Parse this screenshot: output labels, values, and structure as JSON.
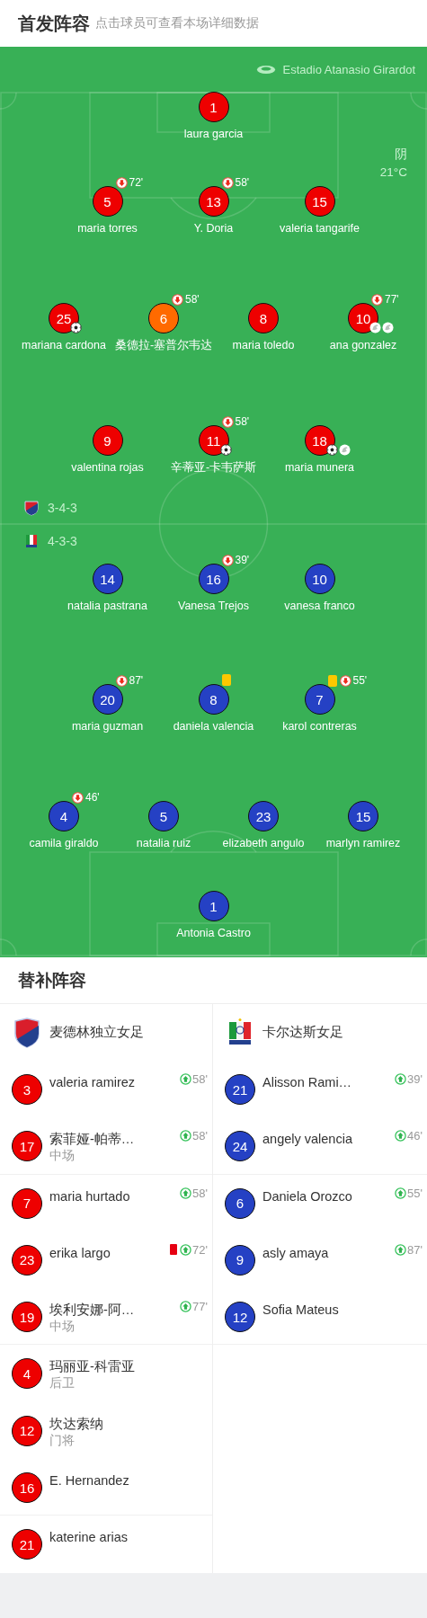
{
  "header": {
    "title": "首发阵容",
    "subtitle": "点击球员可查看本场详细数据"
  },
  "field": {
    "stadium": "Estadio Atanasio Girardot",
    "weather": "阴",
    "temperature": "21°C",
    "home": {
      "formation": "3-4-3",
      "lines": [
        {
          "players": [
            {
              "number": "1",
              "name": "laura garcia",
              "color": "#ee0000"
            }
          ]
        },
        {
          "players": [
            {
              "number": "5",
              "name": "maria torres",
              "color": "#ee0000",
              "events": [
                {
                  "kind": "sub_out",
                  "minute": "72'"
                }
              ]
            },
            {
              "number": "13",
              "name": "Y. Doria",
              "color": "#ee0000",
              "events": [
                {
                  "kind": "sub_out",
                  "minute": "58'"
                }
              ]
            },
            {
              "number": "15",
              "name": "valeria tangarife",
              "color": "#ee0000"
            }
          ]
        },
        {
          "players": [
            {
              "number": "25",
              "name": "mariana cardona",
              "color": "#ee0000",
              "events": [
                {
                  "kind": "goal"
                }
              ]
            },
            {
              "number": "6",
              "name": "桑德拉-塞普尔韦达",
              "color": "#ff6a00",
              "events": [
                {
                  "kind": "sub_out",
                  "minute": "58'"
                }
              ]
            },
            {
              "number": "8",
              "name": "maria toledo",
              "color": "#ee0000"
            },
            {
              "number": "10",
              "name": "ana gonzalez",
              "color": "#ee0000",
              "events": [
                {
                  "kind": "sub_out",
                  "minute": "77'"
                },
                {
                  "kind": "assist"
                },
                {
                  "kind": "assist"
                }
              ]
            }
          ]
        },
        {
          "players": [
            {
              "number": "9",
              "name": "valentina rojas",
              "color": "#ee0000"
            },
            {
              "number": "11",
              "name": "辛蒂亚-卡韦萨斯",
              "color": "#ee0000",
              "events": [
                {
                  "kind": "sub_out",
                  "minute": "58'"
                },
                {
                  "kind": "goal"
                }
              ]
            },
            {
              "number": "18",
              "name": "maria munera",
              "color": "#ee0000",
              "events": [
                {
                  "kind": "goal"
                },
                {
                  "kind": "assist"
                }
              ]
            }
          ]
        }
      ]
    },
    "away": {
      "formation": "4-3-3",
      "lines": [
        {
          "players": [
            {
              "number": "14",
              "name": "natalia pastrana",
              "color": "#2541c4"
            },
            {
              "number": "16",
              "name": "Vanesa Trejos",
              "color": "#2541c4",
              "events": [
                {
                  "kind": "sub_out",
                  "minute": "39'"
                }
              ]
            },
            {
              "number": "10",
              "name": "vanesa franco",
              "color": "#2541c4"
            }
          ]
        },
        {
          "players": [
            {
              "number": "20",
              "name": "maria guzman",
              "color": "#2541c4",
              "events": [
                {
                  "kind": "sub_out",
                  "minute": "87'"
                }
              ]
            },
            {
              "number": "8",
              "name": "daniela valencia",
              "color": "#2541c4",
              "events": [
                {
                  "kind": "yellow"
                }
              ]
            },
            {
              "number": "7",
              "name": "karol contreras",
              "color": "#2541c4",
              "events": [
                {
                  "kind": "yellow"
                },
                {
                  "kind": "sub_out",
                  "minute": "55'"
                }
              ]
            }
          ]
        },
        {
          "players": [
            {
              "number": "4",
              "name": "camila giraldo",
              "color": "#2541c4",
              "events": [
                {
                  "kind": "sub_out",
                  "minute": "46'"
                }
              ]
            },
            {
              "number": "5",
              "name": "natalia ruiz",
              "color": "#2541c4"
            },
            {
              "number": "23",
              "name": "elizabeth angulo",
              "color": "#2541c4"
            },
            {
              "number": "15",
              "name": "marlyn ramirez",
              "color": "#2541c4"
            }
          ]
        },
        {
          "players": [
            {
              "number": "1",
              "name": "Antonia Castro",
              "color": "#2541c4"
            }
          ]
        }
      ]
    }
  },
  "substitutes": {
    "title": "替补阵容",
    "teams": [
      {
        "name": "麦德林独立女足",
        "color": "#ee0000",
        "players": [
          {
            "number": "3",
            "name": "valeria ramirez",
            "events": [
              {
                "kind": "sub_in",
                "minute": "58'"
              }
            ]
          },
          {
            "number": "17",
            "name": "索菲娅-帕蒂…",
            "position": "中场",
            "events": [
              {
                "kind": "sub_in",
                "minute": "58'"
              }
            ]
          },
          {
            "number": "7",
            "name": "maria hurtado",
            "events": [
              {
                "kind": "sub_in",
                "minute": "58'"
              }
            ]
          },
          {
            "number": "23",
            "name": "erika largo",
            "events": [
              {
                "kind": "red"
              },
              {
                "kind": "sub_in",
                "minute": "72'"
              }
            ]
          },
          {
            "number": "19",
            "name": "埃利安娜-阿…",
            "position": "中场",
            "events": [
              {
                "kind": "sub_in",
                "minute": "77'"
              }
            ]
          },
          {
            "number": "4",
            "name": "玛丽亚-科雷亚",
            "position": "后卫"
          },
          {
            "number": "12",
            "name": "坎达索纳",
            "position": "门将"
          },
          {
            "number": "16",
            "name": "E. Hernandez"
          },
          {
            "number": "21",
            "name": "katerine arias"
          }
        ]
      },
      {
        "name": "卡尔达斯女足",
        "color": "#2541c4",
        "players": [
          {
            "number": "21",
            "name": "Alisson Rami…",
            "events": [
              {
                "kind": "sub_in",
                "minute": "39'"
              }
            ]
          },
          {
            "number": "24",
            "name": "angely valencia",
            "events": [
              {
                "kind": "sub_in",
                "minute": "46'"
              }
            ]
          },
          {
            "number": "6",
            "name": "Daniela Orozco",
            "events": [
              {
                "kind": "sub_in",
                "minute": "55'"
              }
            ]
          },
          {
            "number": "9",
            "name": "asly amaya",
            "events": [
              {
                "kind": "sub_in",
                "minute": "87'"
              }
            ]
          },
          {
            "number": "12",
            "name": "Sofia Mateus"
          }
        ]
      }
    ]
  }
}
